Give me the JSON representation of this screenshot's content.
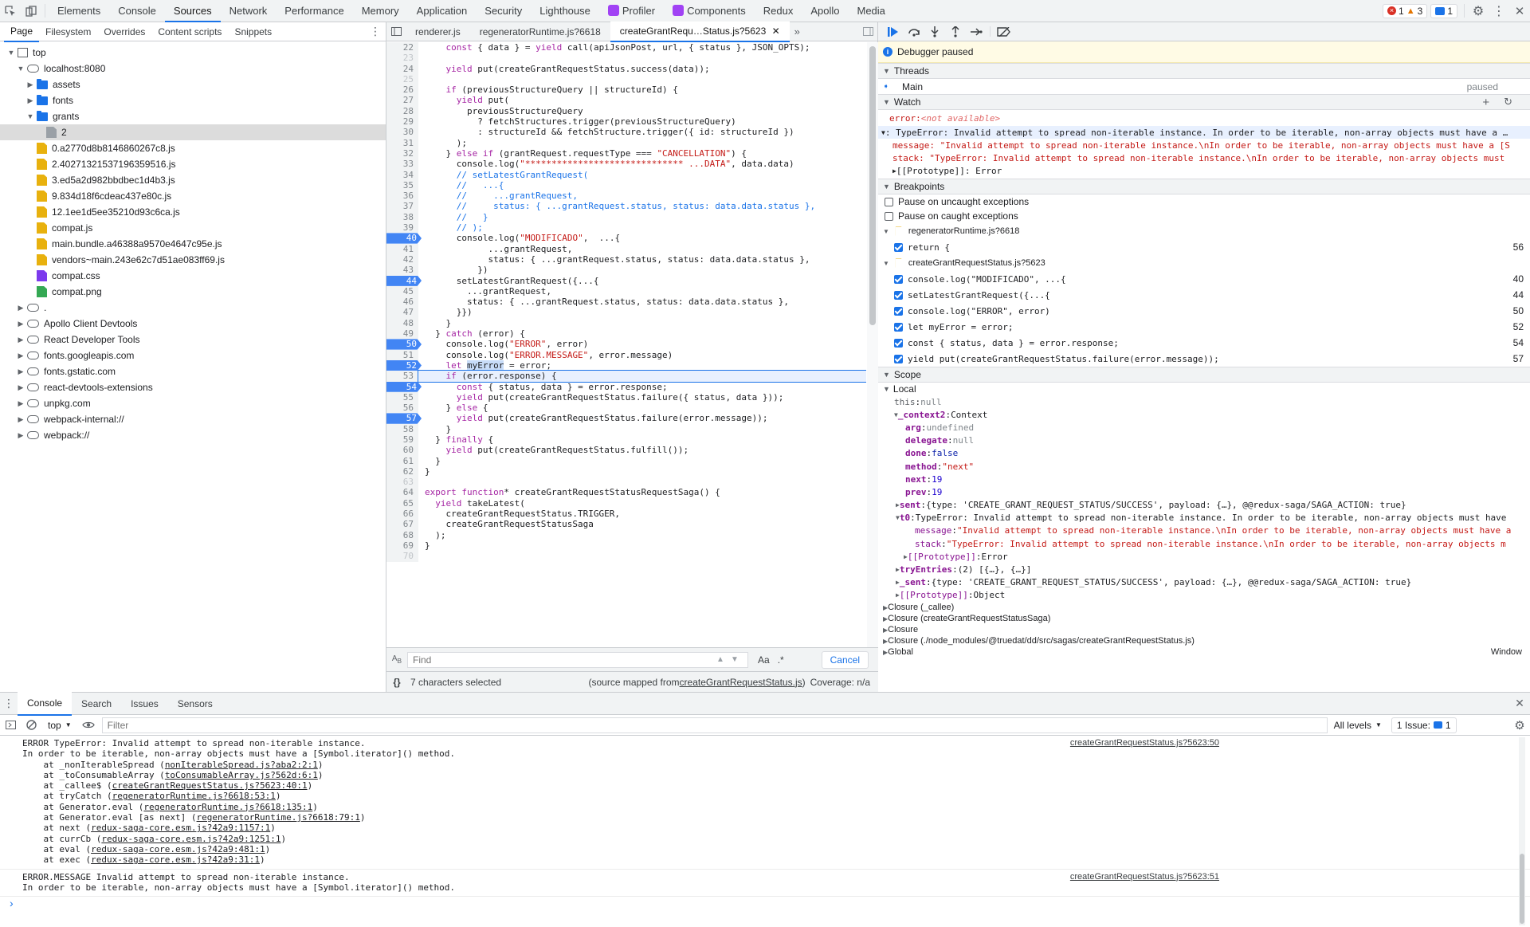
{
  "topbar": {
    "tabs": [
      "Elements",
      "Console",
      "Sources",
      "Network",
      "Performance",
      "Memory",
      "Application",
      "Security",
      "Lighthouse",
      "Profiler",
      "Components",
      "Redux",
      "Apollo",
      "Media"
    ],
    "active_tab": "Sources",
    "errors": "1",
    "warnings": "3",
    "messages": "1"
  },
  "navigator": {
    "tabs": [
      "Page",
      "Filesystem",
      "Overrides",
      "Content scripts",
      "Snippets"
    ],
    "tree": [
      {
        "label": "top",
        "indent": 0,
        "kind": "frame",
        "arrow": "down"
      },
      {
        "label": "localhost:8080",
        "indent": 1,
        "kind": "cloud",
        "arrow": "down"
      },
      {
        "label": "assets",
        "indent": 2,
        "kind": "folder",
        "arrow": "right"
      },
      {
        "label": "fonts",
        "indent": 2,
        "kind": "folder",
        "arrow": "right"
      },
      {
        "label": "grants",
        "indent": 2,
        "kind": "folder",
        "arrow": "down"
      },
      {
        "label": "2",
        "indent": 3,
        "kind": "doc",
        "arrow": "",
        "sel": true
      },
      {
        "label": "0.a2770d8b8146860267c8.js",
        "indent": 2,
        "kind": "js",
        "arrow": ""
      },
      {
        "label": "2.40271321537196359516.js",
        "indent": 2,
        "kind": "js",
        "arrow": ""
      },
      {
        "label": "3.ed5a2d982bbdbec1d4b3.js",
        "indent": 2,
        "kind": "js",
        "arrow": ""
      },
      {
        "label": "9.834d18f6cdeac437e80c.js",
        "indent": 2,
        "kind": "js",
        "arrow": ""
      },
      {
        "label": "12.1ee1d5ee35210d93c6ca.js",
        "indent": 2,
        "kind": "js",
        "arrow": ""
      },
      {
        "label": "compat.js",
        "indent": 2,
        "kind": "js",
        "arrow": ""
      },
      {
        "label": "main.bundle.a46388a9570e4647c95e.js",
        "indent": 2,
        "kind": "js",
        "arrow": ""
      },
      {
        "label": "vendors~main.243e62c7d51ae083ff69.js",
        "indent": 2,
        "kind": "js",
        "arrow": ""
      },
      {
        "label": "compat.css",
        "indent": 2,
        "kind": "css",
        "arrow": ""
      },
      {
        "label": "compat.png",
        "indent": 2,
        "kind": "png",
        "arrow": ""
      },
      {
        "label": ".",
        "indent": 1,
        "kind": "cloud",
        "arrow": "right"
      },
      {
        "label": "Apollo Client Devtools",
        "indent": 1,
        "kind": "cloud",
        "arrow": "right"
      },
      {
        "label": "React Developer Tools",
        "indent": 1,
        "kind": "cloud",
        "arrow": "right"
      },
      {
        "label": "fonts.googleapis.com",
        "indent": 1,
        "kind": "cloud",
        "arrow": "right"
      },
      {
        "label": "fonts.gstatic.com",
        "indent": 1,
        "kind": "cloud",
        "arrow": "right"
      },
      {
        "label": "react-devtools-extensions",
        "indent": 1,
        "kind": "cloud",
        "arrow": "right"
      },
      {
        "label": "unpkg.com",
        "indent": 1,
        "kind": "cloud",
        "arrow": "right"
      },
      {
        "label": "webpack-internal://",
        "indent": 1,
        "kind": "cloud",
        "arrow": "right"
      },
      {
        "label": "webpack://",
        "indent": 1,
        "kind": "cloud",
        "arrow": "right"
      }
    ]
  },
  "editor": {
    "tabs": [
      "renderer.js",
      "regeneratorRuntime.js?6618",
      "createGrantRequ…Status.js?5623"
    ],
    "active_tab": 2,
    "lines": [
      {
        "n": "22",
        "t": "    const { data } = yield call(apiJsonPost, url, { status }, JSON_OPTS);"
      },
      {
        "n": "23",
        "t": ""
      },
      {
        "n": "24",
        "t": "    yield put(createGrantRequestStatus.success(data));"
      },
      {
        "n": "25",
        "t": ""
      },
      {
        "n": "26",
        "t": "    if (previousStructureQuery || structureId) {"
      },
      {
        "n": "27",
        "t": "      yield put("
      },
      {
        "n": "28",
        "t": "        previousStructureQuery"
      },
      {
        "n": "29",
        "t": "          ? fetchStructures.trigger(previousStructureQuery)"
      },
      {
        "n": "30",
        "t": "          : structureId && fetchStructure.trigger({ id: structureId })"
      },
      {
        "n": "31",
        "t": "      );"
      },
      {
        "n": "32",
        "t": "    } else if (grantRequest.requestType === \"CANCELLATION\") {"
      },
      {
        "n": "33",
        "t": "      console.log(\"****************************** ...DATA\", data.data)"
      },
      {
        "n": "34",
        "t": "      // setLatestGrantRequest("
      },
      {
        "n": "35",
        "t": "      //   ...{"
      },
      {
        "n": "36",
        "t": "      //     ...grantRequest,"
      },
      {
        "n": "37",
        "t": "      //     status: { ...grantRequest.status, status: data.data.status },"
      },
      {
        "n": "38",
        "t": "      //   }"
      },
      {
        "n": "39",
        "t": "      // );"
      },
      {
        "n": "40",
        "t": "      console.log(\"MODIFICADO\",  ...{",
        "bp": true
      },
      {
        "n": "41",
        "t": "            ...grantRequest,"
      },
      {
        "n": "42",
        "t": "            status: { ...grantRequest.status, status: data.data.status },"
      },
      {
        "n": "43",
        "t": "          })"
      },
      {
        "n": "44",
        "t": "      setLatestGrantRequest({...{",
        "bp": true
      },
      {
        "n": "45",
        "t": "        ...grantRequest,"
      },
      {
        "n": "46",
        "t": "        status: { ...grantRequest.status, status: data.data.status },"
      },
      {
        "n": "47",
        "t": "      }})"
      },
      {
        "n": "48",
        "t": "    }"
      },
      {
        "n": "49",
        "t": "  } catch (error) {"
      },
      {
        "n": "50",
        "t": "    console.log(\"ERROR\", error)",
        "bp": true
      },
      {
        "n": "51",
        "t": "    console.log(\"ERROR.MESSAGE\", error.message)"
      },
      {
        "n": "52",
        "t": "    let myError = error;",
        "bp": true
      },
      {
        "n": "53",
        "t": "    if (error.response) {",
        "cur": true
      },
      {
        "n": "54",
        "t": "      const { status, data } = error.response;",
        "bp": true
      },
      {
        "n": "55",
        "t": "      yield put(createGrantRequestStatus.failure({ status, data }));"
      },
      {
        "n": "56",
        "t": "    } else {"
      },
      {
        "n": "57",
        "t": "      yield put(createGrantRequestStatus.failure(error.message));",
        "bp": true
      },
      {
        "n": "58",
        "t": "    }"
      },
      {
        "n": "59",
        "t": "  } finally {"
      },
      {
        "n": "60",
        "t": "    yield put(createGrantRequestStatus.fulfill());"
      },
      {
        "n": "61",
        "t": "  }"
      },
      {
        "n": "62",
        "t": "}"
      },
      {
        "n": "63",
        "t": ""
      },
      {
        "n": "64",
        "t": "export function* createGrantRequestStatusRequestSaga() {"
      },
      {
        "n": "65",
        "t": "  yield takeLatest("
      },
      {
        "n": "66",
        "t": "    createGrantRequestStatus.TRIGGER,"
      },
      {
        "n": "67",
        "t": "    createGrantRequestStatusSaga"
      },
      {
        "n": "68",
        "t": "  );"
      },
      {
        "n": "69",
        "t": "}"
      },
      {
        "n": "70",
        "t": ""
      }
    ],
    "find_placeholder": "Find",
    "find_case": "Aa",
    "find_regex": ".*",
    "find_cancel": "Cancel",
    "status_selected": "7 characters selected",
    "status_mapped_prefix": "(source mapped from ",
    "status_mapped_file": "createGrantRequestStatus.js",
    "status_mapped_suffix": ")",
    "status_coverage": "Coverage: n/a"
  },
  "debugger": {
    "paused_label": "Debugger paused",
    "threads_title": "Threads",
    "thread_name": "Main",
    "thread_state": "paused",
    "watch_title": "Watch",
    "watch_error_name": "error",
    "watch_error_value": "<not available>",
    "watch_lines": [
      ": TypeError: Invalid attempt to spread non-iterable instance. In order to be iterable, non-array objects must have a …",
      "message: \"Invalid attempt to spread non-iterable instance.\\nIn order to be iterable, non-array objects must have a [S",
      "stack: \"TypeError: Invalid attempt to spread non-iterable instance.\\nIn order to be iterable, non-array objects must",
      "[[Prototype]]: Error"
    ],
    "breakpoints_title": "Breakpoints",
    "pause_uncaught": "Pause on uncaught exceptions",
    "pause_caught": "Pause on caught exceptions",
    "bp_groups": [
      {
        "file": "regeneratorRuntime.js?6618",
        "items": [
          {
            "code": "return {",
            "line": "56"
          }
        ]
      },
      {
        "file": "createGrantRequestStatus.js?5623",
        "items": [
          {
            "code": "console.log(\"MODIFICADO\", ...{",
            "line": "40"
          },
          {
            "code": "setLatestGrantRequest({...{",
            "line": "44"
          },
          {
            "code": "console.log(\"ERROR\", error)",
            "line": "50"
          },
          {
            "code": "let myError = error;",
            "line": "52"
          },
          {
            "code": "const { status, data } = error.response;",
            "line": "54"
          },
          {
            "code": "yield put(createGrantRequestStatus.failure(error.message));",
            "line": "57"
          }
        ]
      }
    ],
    "scope_title": "Scope",
    "scope_local": "Local",
    "scope_rows": [
      {
        "i": 1,
        "k": "this",
        "v": "null",
        "c": "grey"
      },
      {
        "i": 1,
        "a": "▼",
        "k": "_context2",
        "v": "Context",
        "c": ""
      },
      {
        "i": 2,
        "k": "arg",
        "v": "undefined",
        "c": "grey"
      },
      {
        "i": 2,
        "k": "delegate",
        "v": "null",
        "c": "grey"
      },
      {
        "i": 2,
        "k": "done",
        "v": "false",
        "c": "val-k"
      },
      {
        "i": 2,
        "k": "method",
        "v": "\"next\"",
        "c": "val-s"
      },
      {
        "i": 2,
        "k": "next",
        "v": "19",
        "c": "val-n"
      },
      {
        "i": 2,
        "k": "prev",
        "v": "19",
        "c": "val-n"
      },
      {
        "i": 2,
        "a": "▶",
        "k": "sent",
        "v": "{type: 'CREATE_GRANT_REQUEST_STATUS/SUCCESS', payload: {…}, @@redux-saga/SAGA_ACTION: true}",
        "c": ""
      },
      {
        "i": 2,
        "a": "▼",
        "k": "t0",
        "v": "TypeError: Invalid attempt to spread non-iterable instance. In order to be iterable, non-array objects must have",
        "c": ""
      },
      {
        "i": 3,
        "k": "message",
        "v": "\"Invalid attempt to spread non-iterable instance.\\nIn order to be iterable, non-array objects must have a",
        "c": "val-s"
      },
      {
        "i": 3,
        "k": "stack",
        "v": "\"TypeError: Invalid attempt to spread non-iterable instance.\\nIn order to be iterable, non-array objects m",
        "c": "val-s"
      },
      {
        "i": 3,
        "a": "▶",
        "k": "[[Prototype]]",
        "v": "Error",
        "c": ""
      },
      {
        "i": 2,
        "a": "▶",
        "k": "tryEntries",
        "v": "(2) [{…}, {…}]",
        "c": ""
      },
      {
        "i": 2,
        "a": "▶",
        "k": "_sent",
        "v": "{type: 'CREATE_GRANT_REQUEST_STATUS/SUCCESS', payload: {…}, @@redux-saga/SAGA_ACTION: true}",
        "c": ""
      },
      {
        "i": 2,
        "a": "▶",
        "k": "[[Prototype]]",
        "v": "Object",
        "c": ""
      }
    ],
    "closures": [
      "Closure (_callee)",
      "Closure (createGrantRequestStatusSaga)",
      "Closure",
      "Closure (./node_modules/@truedat/dd/src/sagas/createGrantRequestStatus.js)",
      "Global"
    ],
    "global_value": "Window"
  },
  "drawer": {
    "tabs": [
      "Console",
      "Search",
      "Issues",
      "Sensors"
    ],
    "context": "top",
    "filter_placeholder": "Filter",
    "levels": "All levels",
    "issues_label": "1 Issue:",
    "issues_count": "1",
    "messages": [
      {
        "text": "ERROR TypeError: Invalid attempt to spread non-iterable instance.\nIn order to be iterable, non-array objects must have a [Symbol.iterator]() method.\n    at _nonIterableSpread (nonIterableSpread.js?aba2:2:1)\n    at _toConsumableArray (toConsumableArray.js?562d:6:1)\n    at _callee$ (createGrantRequestStatus.js?5623:40:1)\n    at tryCatch (regeneratorRuntime.js?6618:53:1)\n    at Generator.eval (regeneratorRuntime.js?6618:135:1)\n    at Generator.eval [as next] (regeneratorRuntime.js?6618:79:1)\n    at next (redux-saga-core.esm.js?42a9:1157:1)\n    at currCb (redux-saga-core.esm.js?42a9:1251:1)\n    at eval (redux-saga-core.esm.js?42a9:481:1)\n    at exec (redux-saga-core.esm.js?42a9:31:1)",
        "src": "createGrantRequestStatus.js?5623:50"
      },
      {
        "text": "ERROR.MESSAGE Invalid attempt to spread non-iterable instance.\nIn order to be iterable, non-array objects must have a [Symbol.iterator]() method.",
        "src": "createGrantRequestStatus.js?5623:51"
      }
    ],
    "prompt": "›"
  }
}
